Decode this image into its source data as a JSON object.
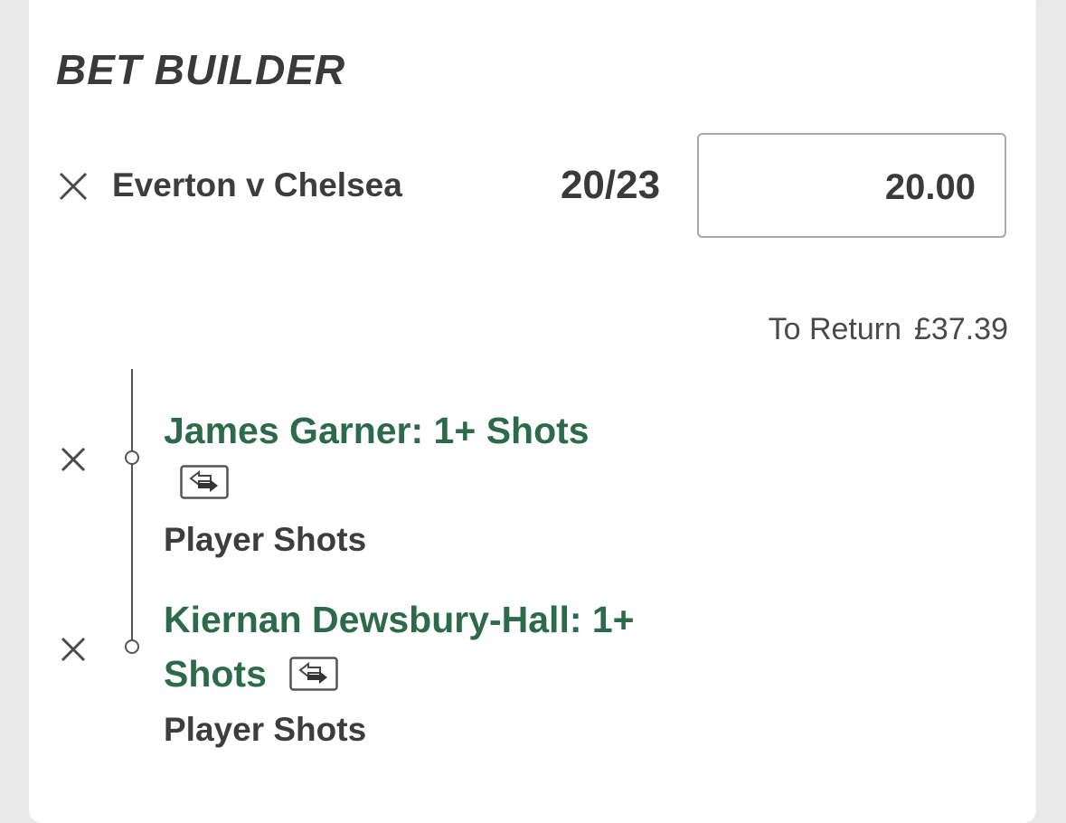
{
  "header": {
    "title": "BET BUILDER"
  },
  "match": {
    "name": "Everton v Chelsea",
    "odds": "20/23",
    "stake": "20.00",
    "to_return_label": "To Return",
    "to_return_value": "£37.39"
  },
  "selections": [
    {
      "title": "James Garner: 1+ Shots",
      "market": "Player Shots"
    },
    {
      "title_line1": "Kiernan Dewsbury-Hall: 1+",
      "title_line2": "Shots",
      "market": "Player Shots"
    }
  ],
  "colors": {
    "selection_green": "#2d6a4b",
    "text_dark": "#3a3a3a",
    "background": "#e9e9ea"
  },
  "icons": [
    "close-icon",
    "swap-icon"
  ]
}
